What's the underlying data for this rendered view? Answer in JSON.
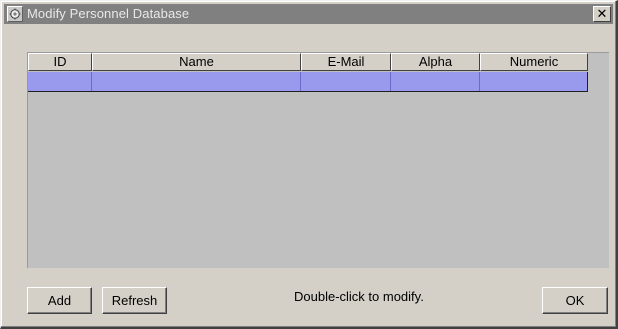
{
  "window": {
    "title": "Modify Personnel Database",
    "close_label": "✕"
  },
  "table": {
    "columns": [
      "ID",
      "Name",
      "E-Mail",
      "Alpha",
      "Numeric"
    ]
  },
  "footer": {
    "add_label": "Add",
    "refresh_label": "Refresh",
    "hint_text": "Double-click to modify.",
    "ok_label": "OK"
  },
  "colors": {
    "selected_row": "#9999ee",
    "titlebar": "#808080",
    "dialog_face": "#d4d0c8"
  }
}
